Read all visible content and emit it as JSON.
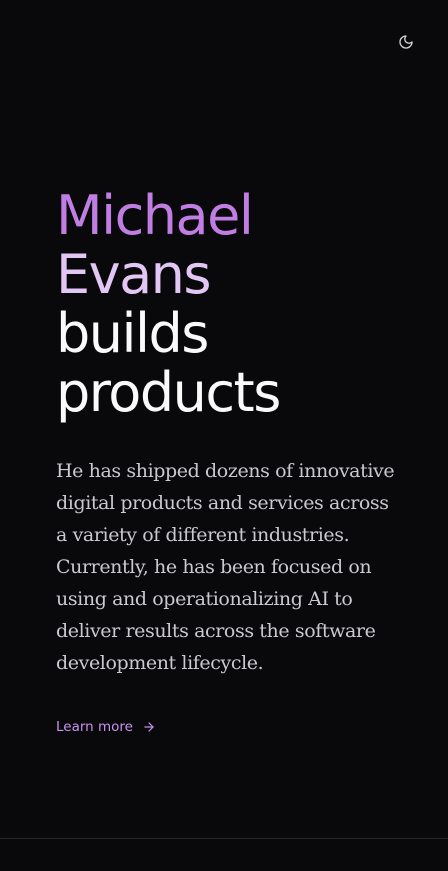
{
  "header": {
    "theme_toggle_icon": "moon-icon"
  },
  "hero": {
    "headline": {
      "first_name": "Michael",
      "last_name": "Evans",
      "line3": "builds",
      "line4": "products"
    },
    "bio": "He has shipped dozens of innovative digital products and services across a variety of different industries. Currently, he has been focused on using and operationalizing AI to deliver results across the software development lifecycle.",
    "cta": {
      "label": "Learn more",
      "icon": "arrow-right-icon"
    }
  },
  "colors": {
    "background": "#09090b",
    "first_name": "#c07ee3",
    "last_name": "#e2c7f5",
    "headline": "#fafafa",
    "body_text": "#c9c9cf",
    "accent": "#c892ef",
    "divider": "#27272a"
  }
}
